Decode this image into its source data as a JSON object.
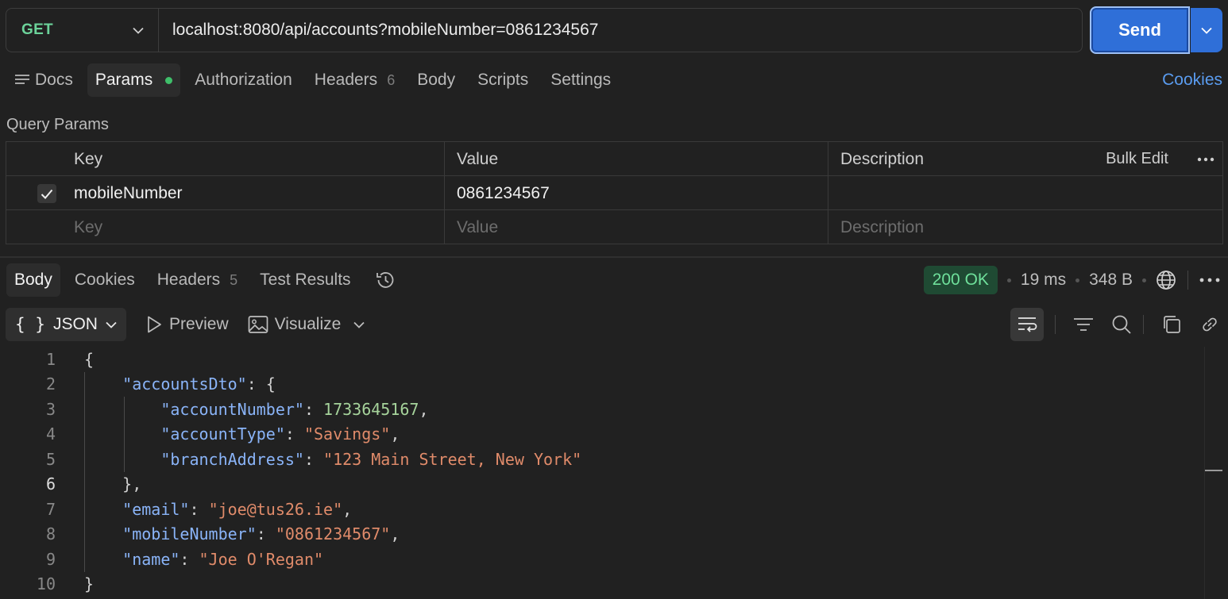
{
  "request": {
    "method": "GET",
    "url": "localhost:8080/api/accounts?mobileNumber=0861234567",
    "send_label": "Send"
  },
  "request_tabs": {
    "docs": "Docs",
    "params": "Params",
    "authorization": "Authorization",
    "headers": "Headers",
    "headers_count": "6",
    "body": "Body",
    "scripts": "Scripts",
    "settings": "Settings",
    "cookies": "Cookies"
  },
  "query_params": {
    "title": "Query Params",
    "headers": {
      "key": "Key",
      "value": "Value",
      "description": "Description"
    },
    "bulk_edit": "Bulk Edit",
    "rows": [
      {
        "checked": true,
        "key": "mobileNumber",
        "value": "0861234567",
        "description": ""
      }
    ],
    "placeholders": {
      "key": "Key",
      "value": "Value",
      "description": "Description"
    }
  },
  "response_tabs": {
    "body": "Body",
    "cookies": "Cookies",
    "headers": "Headers",
    "headers_count": "5",
    "test_results": "Test Results"
  },
  "response_meta": {
    "status": "200 OK",
    "time": "19 ms",
    "size": "348 B"
  },
  "body_toolbar": {
    "format": "JSON",
    "preview": "Preview",
    "visualize": "Visualize"
  },
  "code_lines": [
    "1",
    "2",
    "3",
    "4",
    "5",
    "6",
    "7",
    "8",
    "9",
    "10"
  ],
  "response_json": {
    "accountsDto_key": "\"accountsDto\"",
    "accountNumber_key": "\"accountNumber\"",
    "accountNumber_value": "1733645167",
    "accountType_key": "\"accountType\"",
    "accountType_value": "\"Savings\"",
    "branchAddress_key": "\"branchAddress\"",
    "branchAddress_value": "\"123 Main Street, New York\"",
    "email_key": "\"email\"",
    "email_value": "\"joe@tus26.ie\"",
    "mobileNumber_key": "\"mobileNumber\"",
    "mobileNumber_value": "\"0861234567\"",
    "name_key": "\"name\"",
    "name_value": "\"Joe O'Regan\""
  },
  "colors": {
    "background": "#212121",
    "accent": "#2f6fd8",
    "method_get": "#6cd39a",
    "status_ok": "#6fe09b",
    "json_key": "#8ab4f8",
    "json_string": "#e08b6a",
    "json_number": "#a6d39b"
  },
  "icons": [
    "chevron-down-icon",
    "docs-icon",
    "check-icon",
    "more-horizontal-icon",
    "history-icon",
    "globe-icon",
    "play-icon",
    "image-icon",
    "wrap-icon",
    "filter-icon",
    "search-icon",
    "copy-icon",
    "link-icon"
  ]
}
